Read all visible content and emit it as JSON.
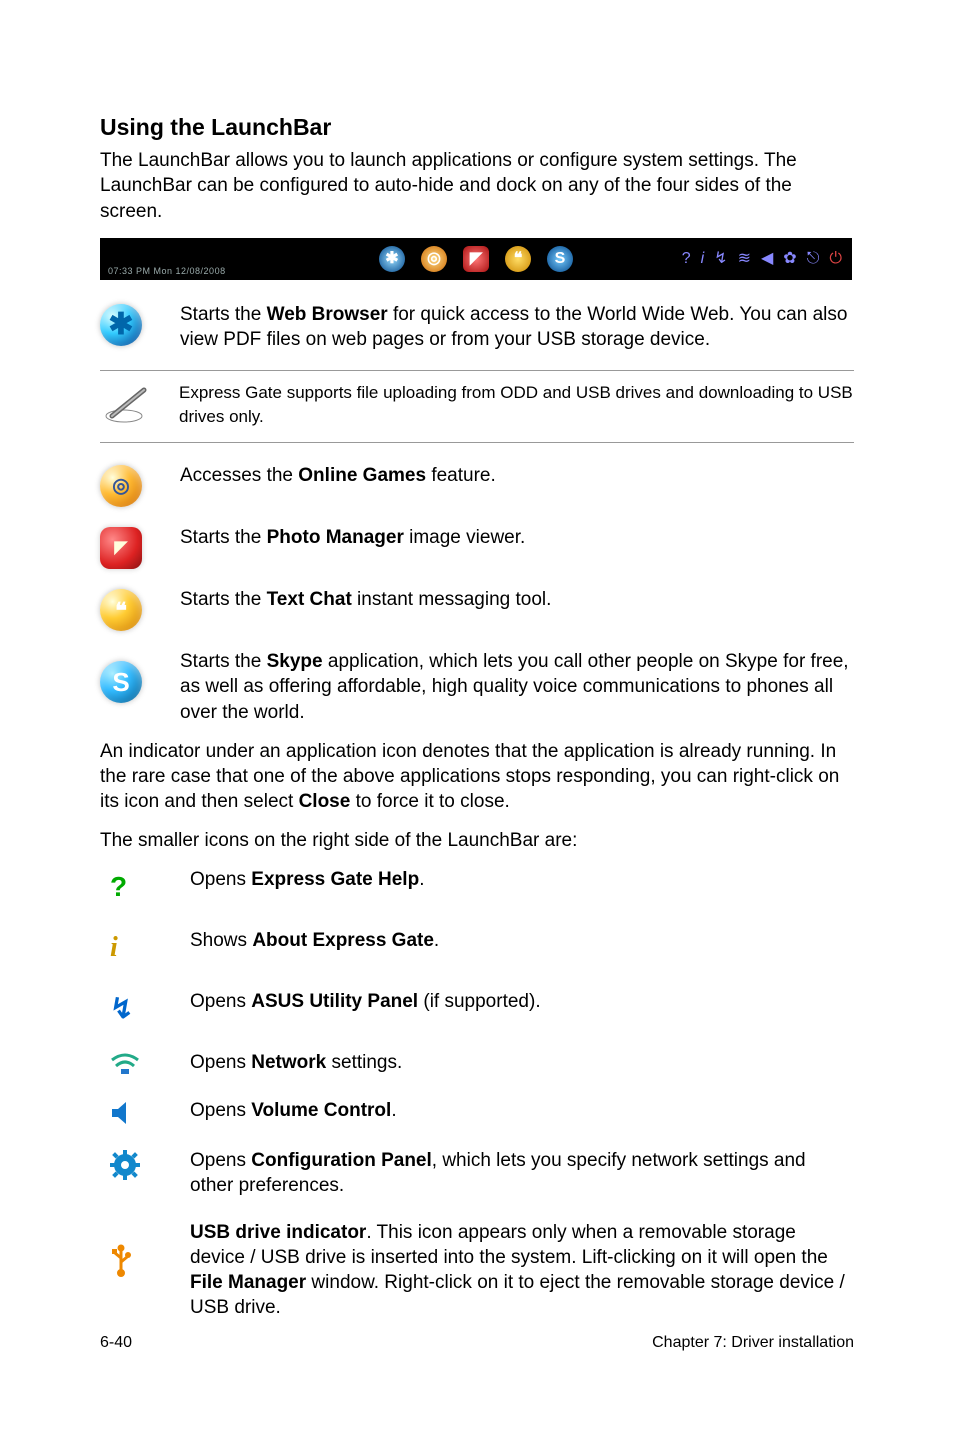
{
  "heading": "Using the LaunchBar",
  "intro": "The LaunchBar allows you to launch applications or configure system settings. The LaunchBar can be configured to auto-hide and dock on any of the four sides of the screen.",
  "launchbar_time": "07:33 PM Mon 12/08/2008",
  "items": [
    {
      "pre": "Starts the ",
      "strong": "Web Browser",
      "post": " for quick access to the World Wide Web. You can also view PDF files on web pages or from your USB storage device."
    }
  ],
  "note": "Express Gate supports file uploading from ODD and USB drives and downloading to USB drives only.",
  "items2": [
    {
      "pre": "Accesses the ",
      "strong": "Online Games",
      "post": " feature."
    },
    {
      "pre": "Starts the ",
      "strong": "Photo Manager",
      "post": " image viewer."
    },
    {
      "pre": "Starts the ",
      "strong": "Text Chat",
      "post": " instant messaging tool."
    },
    {
      "pre": "Starts the ",
      "strong": "Skype",
      "post": " application, which lets you call other people on Skype for free, as well as offering affordable, high quality voice communications to phones all over the world."
    }
  ],
  "para1": "An indicator under an application icon denotes that the application is already running. In the rare case that one of the above applications stops responding, you can right-click on its icon and then select ",
  "para1_strong": "Close",
  "para1_post": " to force it to close.",
  "para2": "The smaller icons on the right side of the LaunchBar are:",
  "small": [
    {
      "pre": "Opens ",
      "strong": "Express Gate Help",
      "post": "."
    },
    {
      "pre": "Shows ",
      "strong": "About Express Gate",
      "post": "."
    },
    {
      "pre": "Opens ",
      "strong": "ASUS Utility Panel",
      "post": " (if supported)."
    },
    {
      "pre": "Opens ",
      "strong": "Network",
      "post": " settings."
    },
    {
      "pre": "Opens ",
      "strong": "Volume Control",
      "post": "."
    },
    {
      "pre": "Opens ",
      "strong": "Configuration Panel",
      "post": ", which lets you specify network settings and other preferences."
    },
    {
      "strong1": "USB drive indicator",
      "mid": ". This icon appears only when a removable storage device / USB drive is inserted into the system. Lift-clicking on it will open the ",
      "strong2": "File Manager",
      "post": " window. Right-click on it to eject the removable storage device / USB drive."
    }
  ],
  "footer_left": "6-40",
  "footer_right": "Chapter 7: Driver installation"
}
